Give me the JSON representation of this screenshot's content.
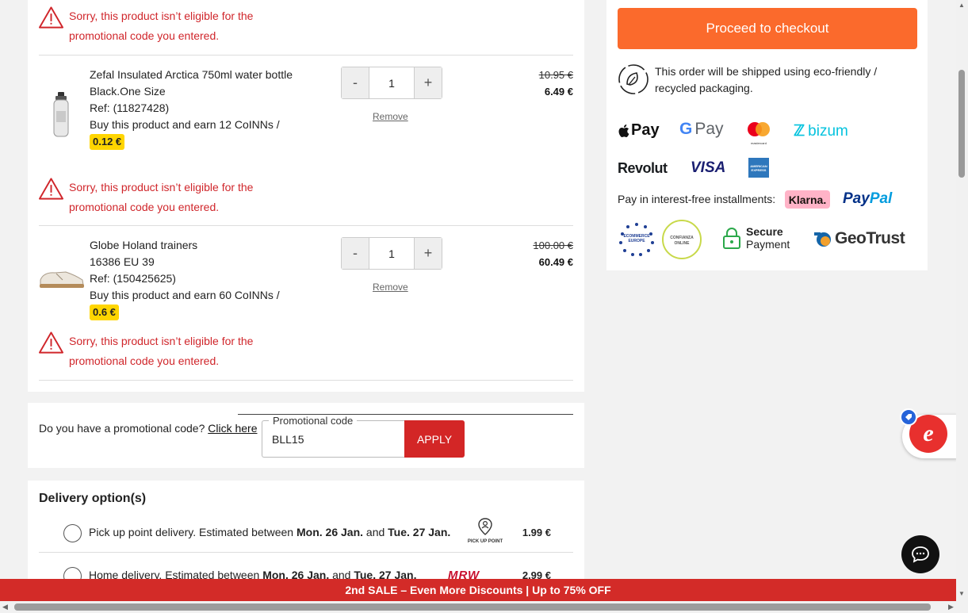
{
  "warning_text": "Sorry, this product isn’t eligible for the promotional code you entered.",
  "items": [
    {
      "name": "Zefal Insulated Arctica 750ml water bottle",
      "variant": "Black.One Size",
      "ref": "Ref: (11827428)",
      "coins_text": "Buy this product and earn 12 CoINNs /",
      "coins_value": "0.12 €",
      "quantity": "1",
      "remove_label": "Remove",
      "old_price": "10.95 €",
      "new_price": "6.49 €"
    },
    {
      "name": "Globe Holand trainers",
      "variant": "16386 EU 39",
      "ref": "Ref: (150425625)",
      "coins_text": "Buy this product and earn 60 CoINNs /",
      "coins_value": "0.6 €",
      "quantity": "1",
      "remove_label": "Remove",
      "old_price": "100.00 €",
      "new_price": "60.49 €"
    }
  ],
  "qty_minus": "-",
  "qty_plus": "+",
  "promo": {
    "question": "Do you have a promotional code?",
    "link": "Click here",
    "field_label": "Promotional code",
    "field_value": "BLL15",
    "apply_label": "APPLY"
  },
  "delivery": {
    "title": "Delivery option(s)",
    "options": [
      {
        "prefix": "Pick up point delivery. Estimated between ",
        "date1": "Mon. 26 Jan.",
        "mid": " and ",
        "date2": "Tue. 27 Jan.",
        "logo_text": "PICK UP POINT",
        "price": "1.99 €"
      },
      {
        "prefix": "Home delivery. Estimated between ",
        "date1": "Mon. 26 Jan.",
        "mid": " and ",
        "date2": "Tue. 27 Jan.",
        "logo_text": "MRW",
        "price": "2.99 €"
      }
    ]
  },
  "sidebar": {
    "checkout_label": "Proceed to checkout",
    "eco_text": "This order will be shipped using eco-friendly / recycled packaging.",
    "payment_logos": {
      "apple_pay": "Pay",
      "google_pay": "Pay",
      "mastercard": "mastercard",
      "bizum": "bizum",
      "revolut": "Revolut",
      "visa": "VISA",
      "amex": "AMERICAN EXPRESS"
    },
    "installments_text": "Pay in interest-free installments:",
    "klarna": "Klarna.",
    "paypal_1": "Pay",
    "paypal_2": "Pal",
    "trust_ecommerce": "ECOMMERCE EUROPE",
    "trust_confianza": "CONFIANZA ONLINE",
    "secure_1": "Secure",
    "secure_2": "Payment",
    "geotrust": "GeoTrust"
  },
  "banner": "2nd SALE – Even More Discounts | Up to 75% OFF",
  "colors": {
    "accent_orange": "#fb6a2c",
    "warning_red": "#d0262b",
    "banner_red": "#d32b28",
    "coin_yellow": "#ffd500"
  }
}
